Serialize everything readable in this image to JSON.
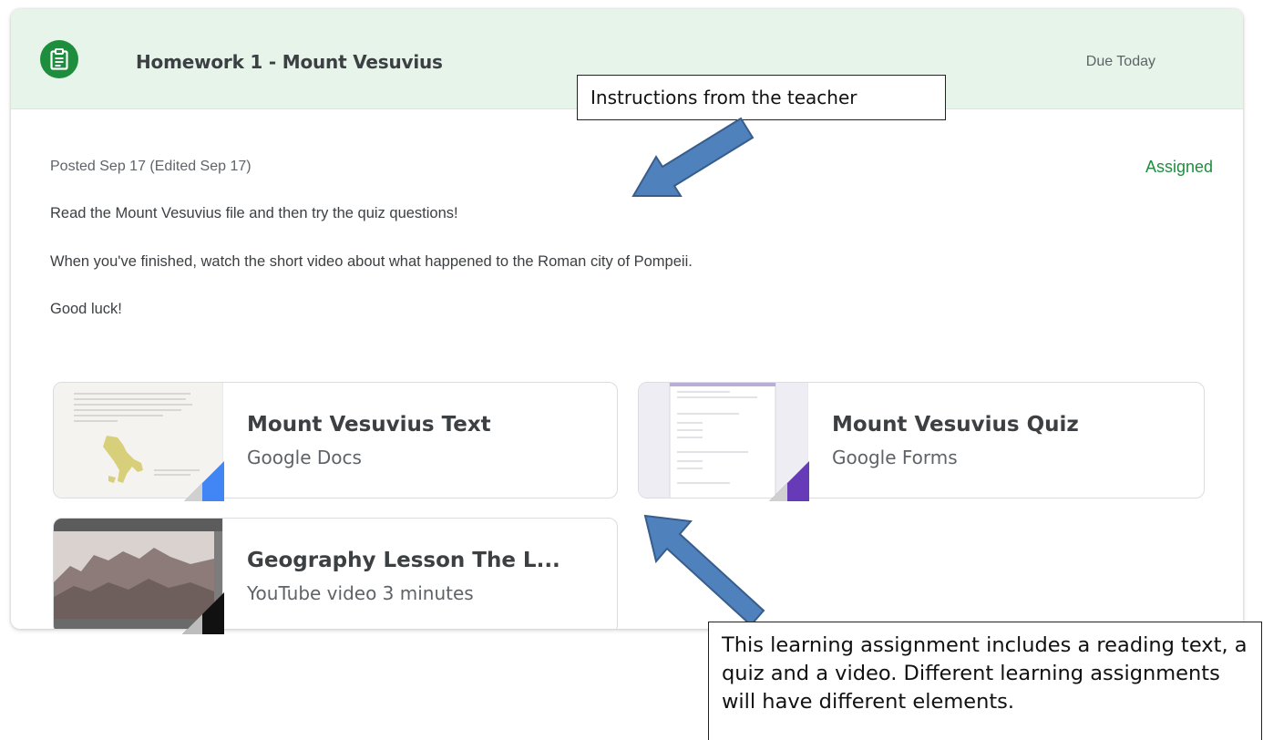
{
  "assignment": {
    "title": "Homework 1 - Mount Vesuvius",
    "due": "Due Today",
    "posted": "Posted Sep 17 (Edited Sep 17)",
    "status": "Assigned",
    "instructions": [
      "Read the Mount Vesuvius file and then try the quiz questions!",
      "When you've finished, watch the short video about what happened to the Roman city of Pompeii.",
      "Good luck!"
    ]
  },
  "attachments": [
    {
      "title": "Mount Vesuvius Text",
      "type": "Google Docs",
      "accent": "#4285f4",
      "icon": "docs-thumbnail"
    },
    {
      "title": "Mount Vesuvius Quiz",
      "type": "Google Forms",
      "accent": "#673ab7",
      "icon": "forms-thumbnail"
    },
    {
      "title": "Geography Lesson The L...",
      "type": "YouTube video   3 minutes",
      "accent": "#111111",
      "icon": "video-thumbnail"
    }
  ],
  "callouts": {
    "teacher": "Instructions from the teacher",
    "assignment_note": "This learning assignment includes a reading text, a quiz and a video. Different learning assignments will have different elements."
  },
  "colors": {
    "header_bg": "#e6f4ea",
    "brand_green": "#1e8e3e",
    "arrow_fill": "#4f81bd",
    "arrow_stroke": "#385d8a"
  },
  "icons": {
    "assignment": "assignment-clipboard-icon"
  }
}
